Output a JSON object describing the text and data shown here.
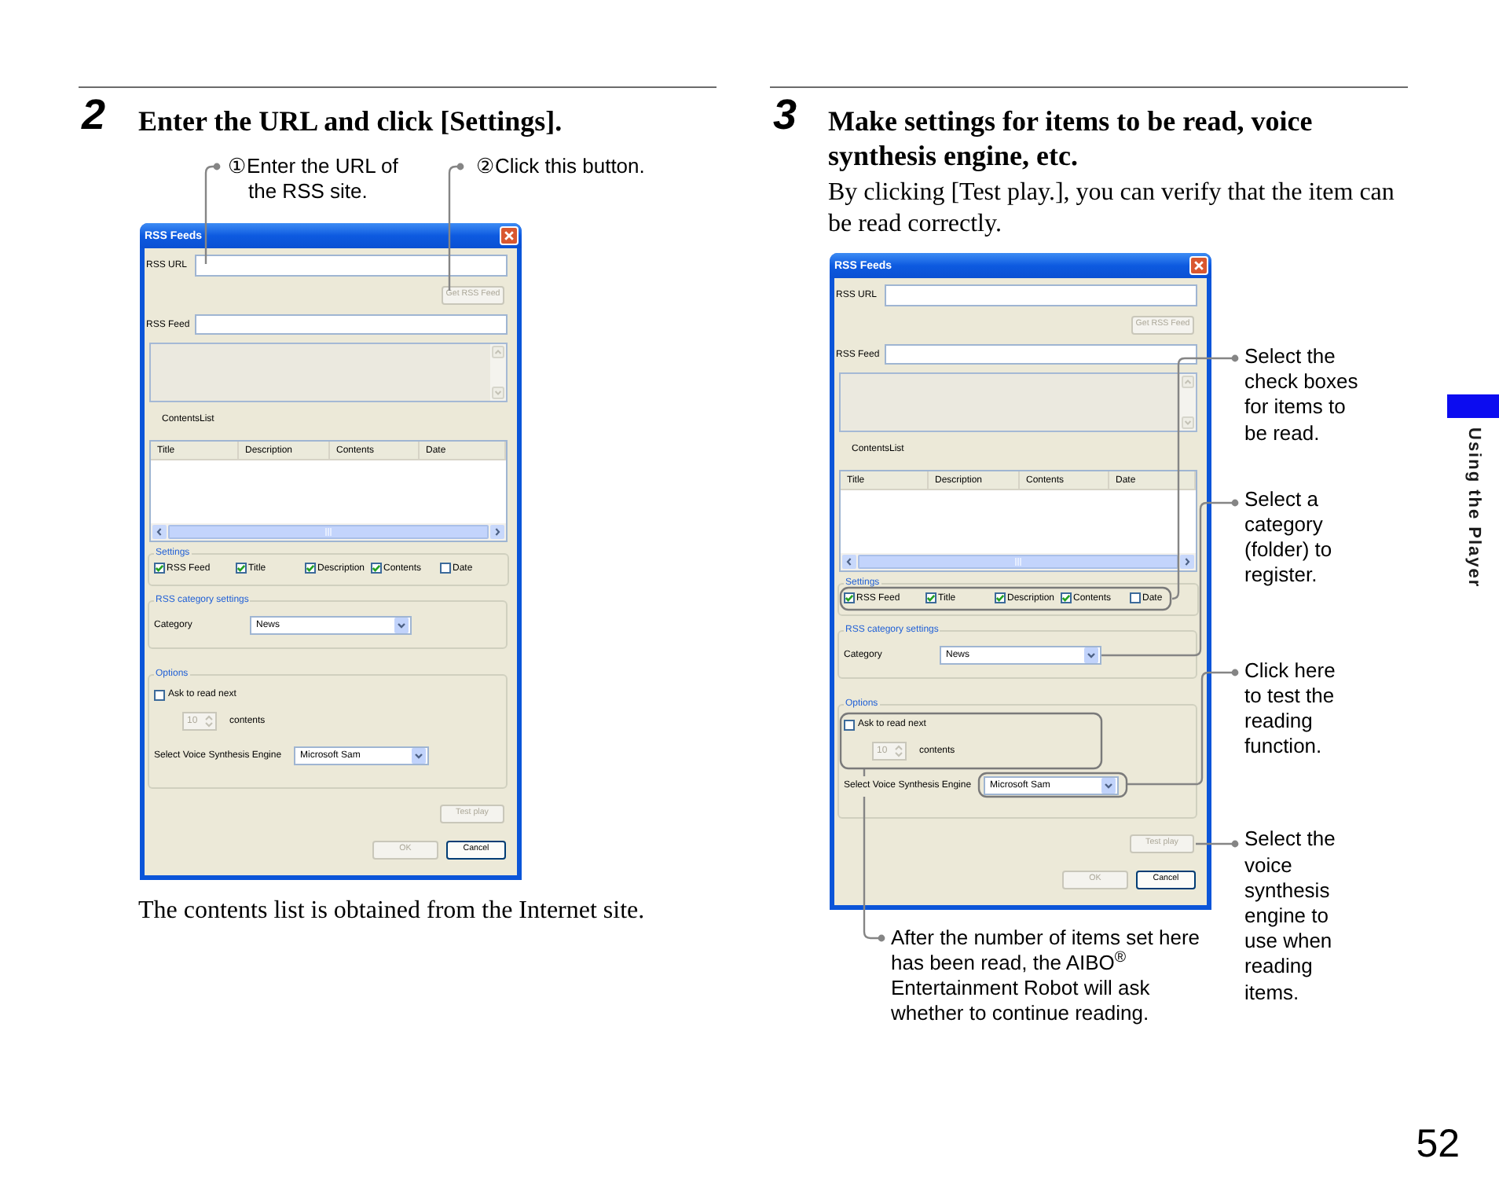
{
  "steps": [
    {
      "number": "2",
      "heading": "Enter the URL and click [Settings].",
      "callouts": [
        "①Enter the URL of\nthe RSS site.",
        "②Click this button."
      ],
      "dialog": {
        "title": "RSS Feeds",
        "url_label": "RSS URL",
        "get_feed_button": {
          "label": "Get RSS Feed",
          "disabled": true
        },
        "feed_label": "RSS Feed",
        "list_label": "ContentsList",
        "columns": [
          "Title",
          "Description",
          "Contents",
          "Date"
        ],
        "settings": {
          "legend": "Settings",
          "items": [
            {
              "label": "RSS Feed",
              "checked": true
            },
            {
              "label": "Title",
              "checked": true
            },
            {
              "label": "Description",
              "checked": true
            },
            {
              "label": "Contents",
              "checked": true
            },
            {
              "label": "Date",
              "checked": false
            }
          ]
        },
        "category": {
          "legend": "RSS category settings",
          "label": "Category",
          "value": "News"
        },
        "options": {
          "legend": "Options",
          "ask_next": {
            "label": "Ask to read next",
            "checked": false
          },
          "count": {
            "value": "10",
            "disabled": true
          },
          "count_unit": "contents",
          "engine_label": "Select Voice Synthesis Engine",
          "engine_value": "Microsoft Sam"
        },
        "test_button": {
          "label": "Test play",
          "disabled": true
        },
        "buttons": [
          {
            "label": "OK",
            "disabled": true
          },
          {
            "label": "Cancel",
            "disabled": false
          }
        ]
      },
      "caption": "The contents list is obtained from the Internet site."
    },
    {
      "number": "3",
      "heading": "Make settings for items to be read, voice synthesis engine, etc.",
      "intro": "By clicking [Test play.], you can verify that the item can be read correctly.",
      "dialog": {
        "title": "RSS Feeds",
        "url_label": "RSS URL",
        "get_feed_button": {
          "label": "Get RSS Feed",
          "disabled": true
        },
        "feed_label": "RSS Feed",
        "list_label": "ContentsList",
        "columns": [
          "Title",
          "Description",
          "Contents",
          "Date"
        ],
        "settings": {
          "legend": "Settings",
          "items": [
            {
              "label": "RSS Feed",
              "checked": true
            },
            {
              "label": "Title",
              "checked": true
            },
            {
              "label": "Description",
              "checked": true
            },
            {
              "label": "Contents",
              "checked": true
            },
            {
              "label": "Date",
              "checked": false
            }
          ]
        },
        "category": {
          "legend": "RSS category settings",
          "label": "Category",
          "value": "News"
        },
        "options": {
          "legend": "Options",
          "ask_next": {
            "label": "Ask to read next",
            "checked": false
          },
          "count": {
            "value": "10",
            "disabled": true
          },
          "count_unit": "contents",
          "engine_label": "Select Voice Synthesis Engine",
          "engine_value": "Microsoft Sam"
        },
        "test_button": {
          "label": "Test play",
          "disabled": true
        },
        "buttons": [
          {
            "label": "OK",
            "disabled": true
          },
          {
            "label": "Cancel",
            "disabled": false
          }
        ]
      },
      "callouts": [
        "Select the\ncheck boxes\nfor items to\nbe read.",
        "Select a\ncategory\n(folder) to\nregister.",
        "Click here\nto test the\nreading\nfunction.",
        "Select the\nvoice\nsynthesis\nengine to\nuse when\nreading\nitems."
      ],
      "note": "After the number of items set here\nhas been read, the AIBO$^{®}$\nEntertainment Robot will ask\nwhether to continue reading."
    }
  ],
  "side_tab": "Using the Player",
  "page_number": "52"
}
